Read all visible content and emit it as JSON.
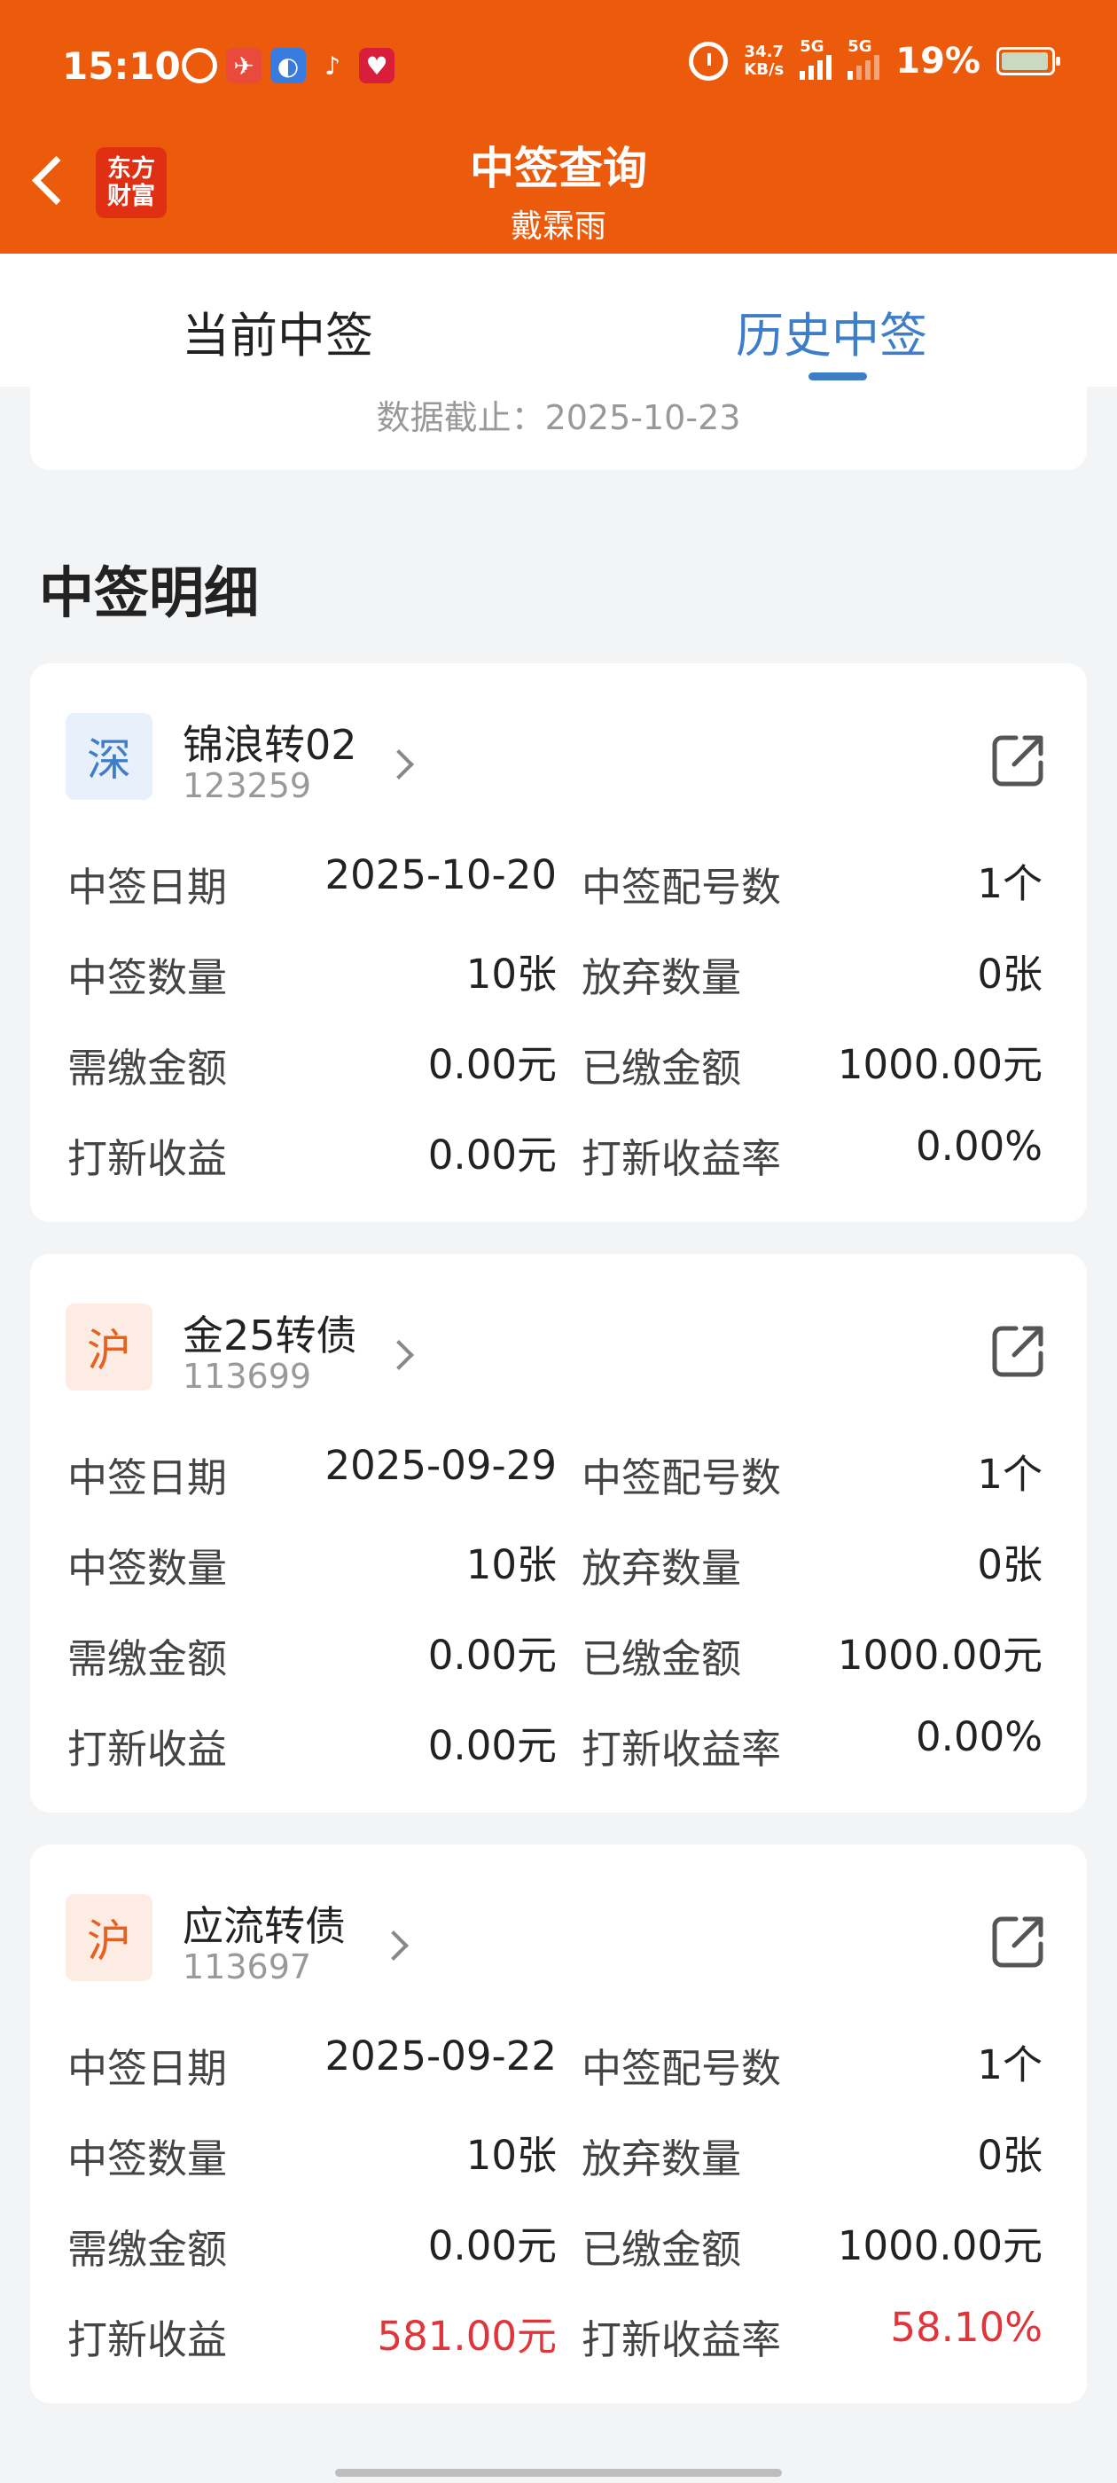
{
  "status_bar": {
    "time": "15:10",
    "net_speed_value": "34.7",
    "net_speed_unit": "KB/s",
    "signal1_label": "5G",
    "signal2_label": "5G",
    "battery": "19%"
  },
  "header": {
    "logo_text": "东方财富",
    "title": "中签查询",
    "subtitle": "戴霖雨"
  },
  "tabs": [
    {
      "label": "当前中签",
      "active": false
    },
    {
      "label": "历史中签",
      "active": true
    }
  ],
  "summary": {
    "data_deadline": "数据截止：2025-10-23"
  },
  "section_title": "中签明细",
  "labels": {
    "win_date": "中签日期",
    "win_count": "中签配号数",
    "win_qty": "中签数量",
    "abandon_qty": "放弃数量",
    "due_amount": "需缴金额",
    "paid_amount": "已缴金额",
    "profit": "打新收益",
    "profit_rate": "打新收益率"
  },
  "records": [
    {
      "market": "深",
      "name": "锦浪转02",
      "code": "123259",
      "win_date": "2025-10-20",
      "win_count": "1个",
      "win_qty": "10张",
      "abandon_qty": "0张",
      "due_amount": "0.00元",
      "paid_amount": "1000.00元",
      "profit": "0.00元",
      "profit_rate": "0.00%"
    },
    {
      "market": "沪",
      "name": "金25转债",
      "code": "113699",
      "win_date": "2025-09-29",
      "win_count": "1个",
      "win_qty": "10张",
      "abandon_qty": "0张",
      "due_amount": "0.00元",
      "paid_amount": "1000.00元",
      "profit": "0.00元",
      "profit_rate": "0.00%"
    },
    {
      "market": "沪",
      "name": "应流转债",
      "code": "113697",
      "win_date": "2025-09-22",
      "win_count": "1个",
      "win_qty": "10张",
      "abandon_qty": "0张",
      "due_amount": "0.00元",
      "paid_amount": "1000.00元",
      "profit": "581.00元",
      "profit_rate": "58.10%"
    }
  ],
  "colors": {
    "brand_orange": "#ec5a0b",
    "accent_blue": "#3e7ec9",
    "profit_red": "#e0353b"
  }
}
